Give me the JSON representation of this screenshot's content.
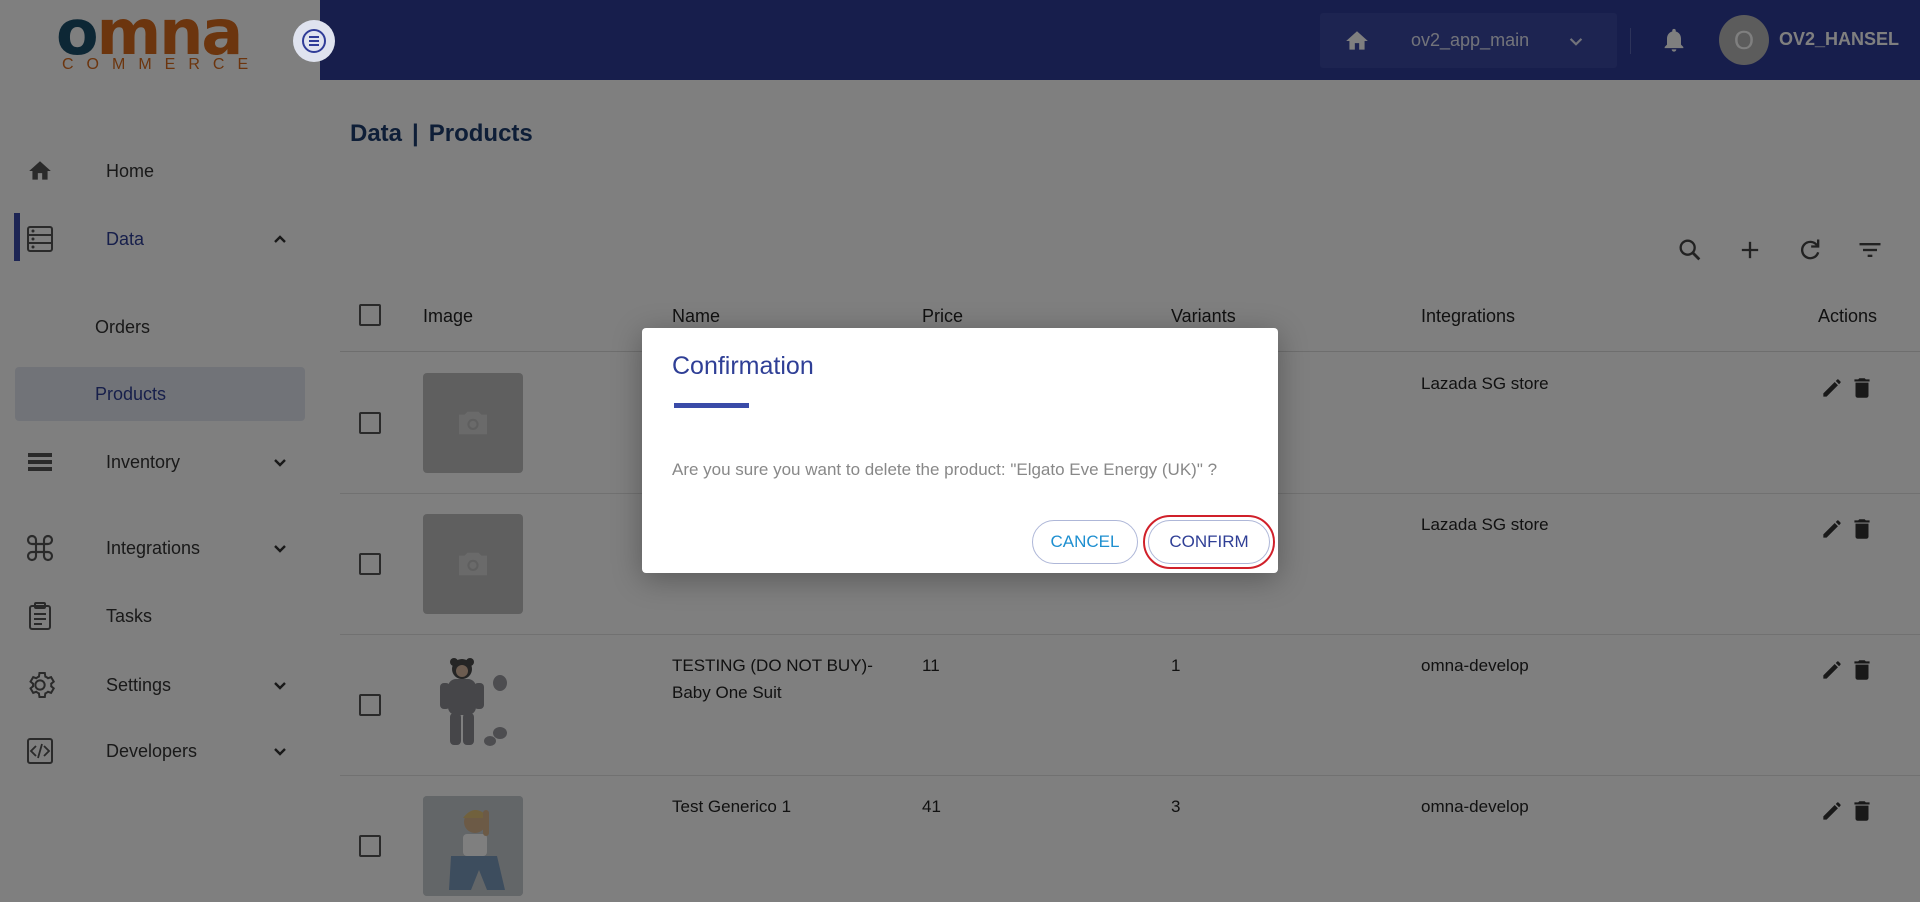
{
  "brand": {
    "name": "omna",
    "tagline": "COMMERCE"
  },
  "header": {
    "app_name": "ov2_app_main",
    "avatar_letter": "O",
    "username": "OV2_HANSEL"
  },
  "sidebar": {
    "items": [
      {
        "label": "Home",
        "icon": "home-icon"
      },
      {
        "label": "Data",
        "icon": "database-icon"
      },
      {
        "label": "Inventory",
        "icon": "list-icon"
      },
      {
        "label": "Integrations",
        "icon": "command-icon"
      },
      {
        "label": "Tasks",
        "icon": "clipboard-icon"
      },
      {
        "label": "Settings",
        "icon": "gear-icon"
      },
      {
        "label": "Developers",
        "icon": "code-icon"
      }
    ],
    "sub_items": [
      {
        "label": "Orders"
      },
      {
        "label": "Products"
      }
    ]
  },
  "breadcrumb": {
    "section": "Data",
    "separator": "|",
    "page": "Products"
  },
  "table": {
    "columns": [
      "Image",
      "Name",
      "Price",
      "Variants",
      "Integrations",
      "Actions"
    ],
    "rows": [
      {
        "name": "",
        "price": "",
        "variants": "",
        "integration": "Lazada SG store",
        "image": "placeholder"
      },
      {
        "name": "",
        "price": "",
        "variants": "",
        "integration": "Lazada SG store",
        "image": "placeholder"
      },
      {
        "name": "TESTING (DO NOT BUY)-Baby One Suit",
        "price": "11",
        "variants": "1",
        "integration": "omna-develop",
        "image": "baby-suit"
      },
      {
        "name": "Test Generico 1",
        "price": "41",
        "variants": "3",
        "integration": "omna-develop",
        "image": "model-photo"
      }
    ]
  },
  "modal": {
    "title": "Confirmation",
    "message": "Are you sure you want to delete the product: \"Elgato Eve Energy (UK)\" ?",
    "cancel_label": "CANCEL",
    "confirm_label": "CONFIRM"
  },
  "colors": {
    "header": "#2f3c98",
    "accent": "#2f3f96",
    "cancel_text": "#1e8fd0",
    "highlight": "#d0202a"
  }
}
